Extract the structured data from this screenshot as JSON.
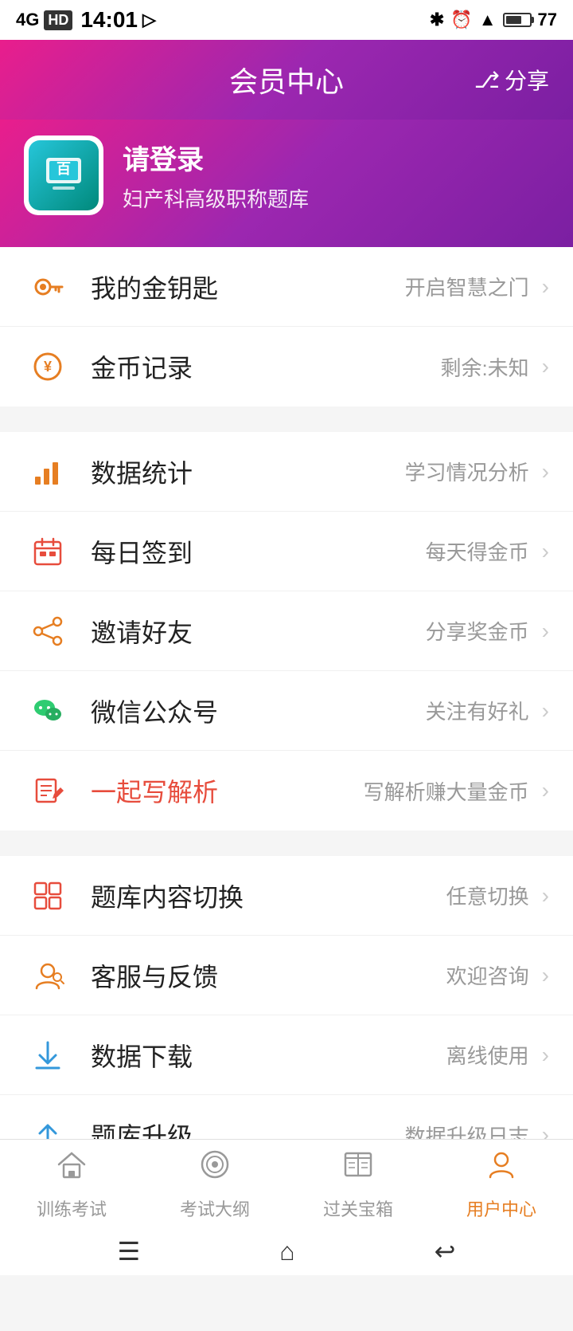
{
  "statusBar": {
    "time": "14:01",
    "signal": "4G",
    "hd": "HD",
    "bluetooth": "⊛",
    "wifi": "WiFi",
    "battery": "77"
  },
  "header": {
    "title": "会员中心",
    "shareLabel": "分享"
  },
  "profile": {
    "loginText": "请登录",
    "subtitle": "妇产科高级职称题库"
  },
  "menuSections": [
    {
      "id": "section1",
      "items": [
        {
          "id": "golden-key",
          "label": "我的金钥匙",
          "desc": "开启智慧之门",
          "iconType": "key",
          "highlight": false
        },
        {
          "id": "coin-record",
          "label": "金币记录",
          "desc": "剩余:未知",
          "iconType": "coin",
          "highlight": false
        }
      ]
    },
    {
      "id": "section2",
      "items": [
        {
          "id": "data-stats",
          "label": "数据统计",
          "desc": "学习情况分析",
          "iconType": "chart",
          "highlight": false
        },
        {
          "id": "daily-signin",
          "label": "每日签到",
          "desc": "每天得金币",
          "iconType": "calendar",
          "highlight": false
        },
        {
          "id": "invite-friends",
          "label": "邀请好友",
          "desc": "分享奖金币",
          "iconType": "share",
          "highlight": false
        },
        {
          "id": "wechat-official",
          "label": "微信公众号",
          "desc": "关注有好礼",
          "iconType": "wechat",
          "highlight": false
        },
        {
          "id": "write-analysis",
          "label": "一起写解析",
          "desc": "写解析赚大量金币",
          "iconType": "write",
          "highlight": true
        }
      ]
    },
    {
      "id": "section3",
      "items": [
        {
          "id": "switch-content",
          "label": "题库内容切换",
          "desc": "任意切换",
          "iconType": "switch",
          "highlight": false
        },
        {
          "id": "customer-service",
          "label": "客服与反馈",
          "desc": "欢迎咨询",
          "iconType": "service",
          "highlight": false
        },
        {
          "id": "data-download",
          "label": "数据下载",
          "desc": "离线使用",
          "iconType": "download",
          "highlight": false
        },
        {
          "id": "upgrade",
          "label": "题库升级",
          "desc": "数据升级日志",
          "iconType": "upgrade",
          "highlight": false
        }
      ]
    }
  ],
  "bottomNav": {
    "items": [
      {
        "id": "train",
        "label": "训练考试",
        "iconType": "home",
        "active": false
      },
      {
        "id": "outline",
        "label": "考试大纲",
        "iconType": "target",
        "active": false
      },
      {
        "id": "treasure",
        "label": "过关宝箱",
        "iconType": "book",
        "active": false
      },
      {
        "id": "user",
        "label": "用户中心",
        "iconType": "user",
        "active": true
      }
    ]
  }
}
